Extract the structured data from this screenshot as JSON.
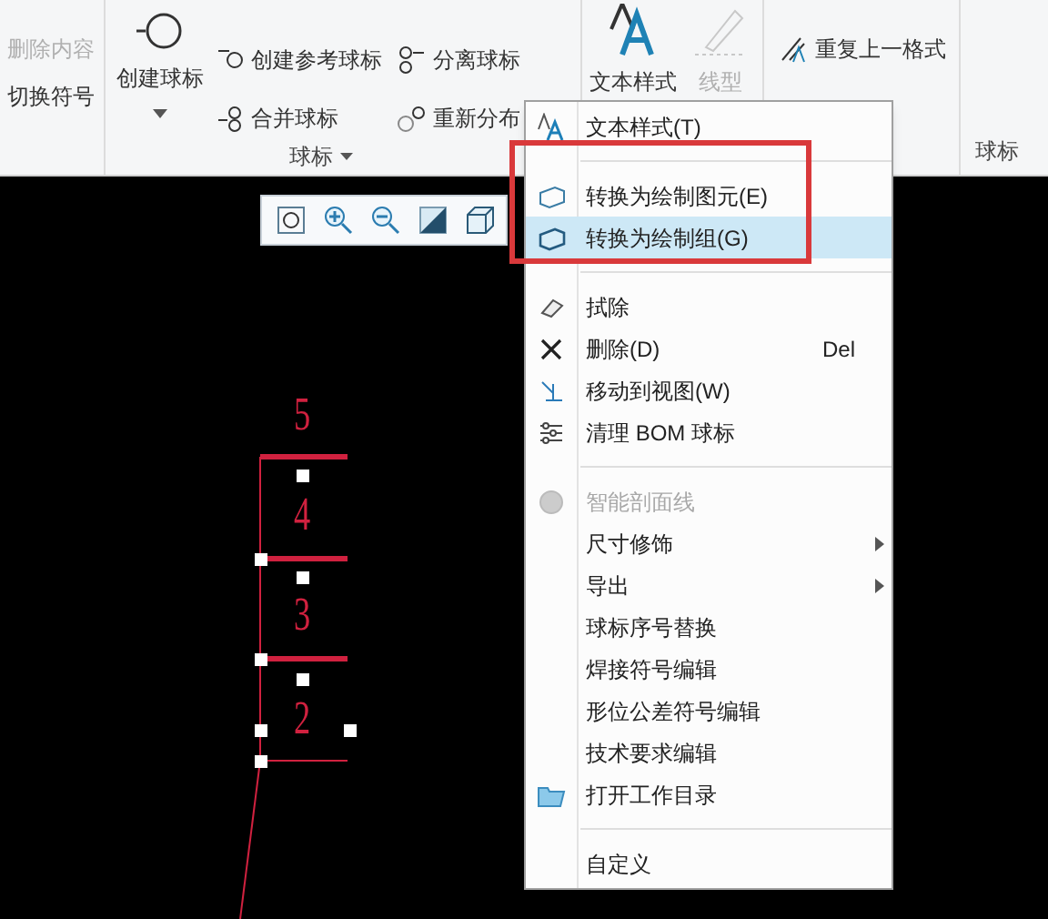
{
  "ribbon": {
    "groups": [
      {
        "items": [
          {
            "text": "删除内容",
            "disabled": true
          },
          {
            "text": "切换符号",
            "disabled": false
          }
        ]
      },
      {
        "label": "球标",
        "big": "创建球标",
        "items": [
          {
            "text": "创建参考球标",
            "disabled": false
          },
          {
            "text": "合并球标",
            "disabled": false
          },
          {
            "text": "分离球标",
            "disabled": false
          },
          {
            "text": "重新分布",
            "disabled": false
          }
        ]
      },
      {
        "bigs": [
          {
            "text": "文本样式",
            "disabled": false
          },
          {
            "text": "线型",
            "disabled": true
          }
        ]
      },
      {
        "items": [
          {
            "text": "重复上一格式",
            "disabled": false
          }
        ]
      },
      {
        "label": "球标"
      }
    ]
  },
  "menu": {
    "items": [
      {
        "kind": "item",
        "label": "文本样式(T)",
        "selected": false,
        "disabled": false
      },
      {
        "kind": "separator"
      },
      {
        "kind": "item",
        "label": "转换为绘制图元(E)",
        "selected": false,
        "disabled": false
      },
      {
        "kind": "item",
        "label": "转换为绘制组(G)",
        "selected": true,
        "disabled": false
      },
      {
        "kind": "separator"
      },
      {
        "kind": "item",
        "label": "拭除",
        "selected": false,
        "disabled": false
      },
      {
        "kind": "item",
        "label": "删除(D)",
        "shortcut": "Del",
        "selected": false,
        "disabled": false
      },
      {
        "kind": "item",
        "label": "移动到视图(W)",
        "selected": false,
        "disabled": false
      },
      {
        "kind": "item",
        "label": "清理 BOM 球标",
        "selected": false,
        "disabled": false
      },
      {
        "kind": "separator"
      },
      {
        "kind": "item",
        "label": "智能剖面线",
        "selected": false,
        "disabled": true
      },
      {
        "kind": "item",
        "label": "尺寸修饰",
        "submenu": true,
        "selected": false,
        "disabled": false
      },
      {
        "kind": "item",
        "label": "导出",
        "submenu": true,
        "selected": false,
        "disabled": false
      },
      {
        "kind": "item",
        "label": "球标序号替换",
        "selected": false,
        "disabled": false
      },
      {
        "kind": "item",
        "label": "焊接符号编辑",
        "selected": false,
        "disabled": false
      },
      {
        "kind": "item",
        "label": "形位公差符号编辑",
        "selected": false,
        "disabled": false
      },
      {
        "kind": "item",
        "label": "技术要求编辑",
        "selected": false,
        "disabled": false
      },
      {
        "kind": "item",
        "label": "打开工作目录",
        "selected": false,
        "disabled": false
      },
      {
        "kind": "separator"
      },
      {
        "kind": "item",
        "label": "自定义",
        "selected": false,
        "disabled": false
      }
    ]
  },
  "balloons": [
    "5",
    "4",
    "3",
    "2"
  ]
}
